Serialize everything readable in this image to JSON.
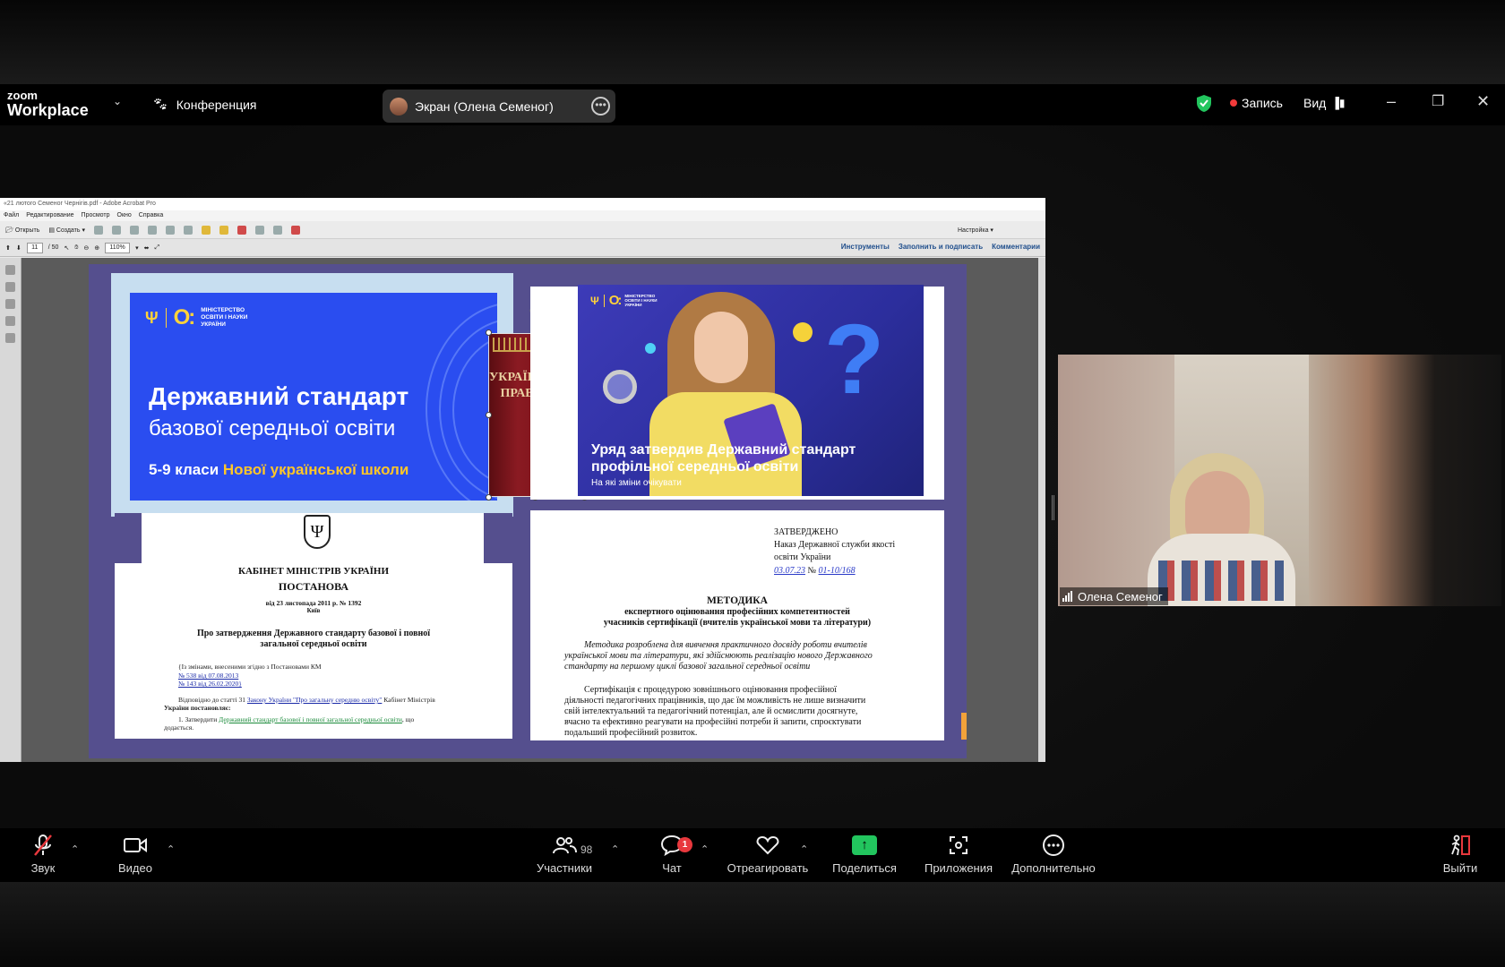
{
  "app": {
    "logo_small": "zoom",
    "logo_big": "Workplace",
    "conference_label": "Конференция",
    "screen_pill": "Экран (Олена Семеног)",
    "record_label": "Запись",
    "view_label": "Вид"
  },
  "acrobat": {
    "title": "«21 лютого Семеног Чернігів.pdf - Adobe Acrobat Pro",
    "menu": [
      "Файл",
      "Редактирование",
      "Просмотр",
      "Окно",
      "Справка"
    ],
    "open_label": "Открыть",
    "create_label": "Создать",
    "settings_label": "Настройка",
    "page_current": "11",
    "page_total": "/ 50",
    "zoom": "110%",
    "right_links": [
      "Инструменты",
      "Заполнить и подписать",
      "Комментарии"
    ]
  },
  "slide1": {
    "ministry": "МІНІСТЕРСТВО ОСВІТИ І НАУКИ УКРАЇНИ",
    "title1": "Державний стандарт",
    "title2": "базової середньої освіти",
    "grades": "5-9 класи",
    "grades_accent": "Нової української школи"
  },
  "book": {
    "title": "УКРАЇНСЬКИЙ ПРАВОПИС"
  },
  "slide2": {
    "ministry": "МІНІСТЕРСТВО ОСВІТИ І НАУКИ УКРАЇНИ",
    "caption1": "Уряд затвердив Державний стандарт",
    "caption2": "профільної середньої освіти",
    "sub": "На які зміни очікувати"
  },
  "doc1": {
    "org": "КАБІНЕТ МІНІСТРІВ УКРАЇНИ",
    "kind": "ПОСТАНОВА",
    "date": "від 23 листопада 2011 р. № 1392",
    "city": "Київ",
    "title1": "Про затвердження Державного стандарту базової і повної",
    "title2": "загальної середньої освіти",
    "changes": "{Із змінами, внесеними згідно з Постановами КМ",
    "change1": "№ 538 від 07.08.2013",
    "change2": "№ 143 від 26.02.2020}",
    "para1_a": "Відповідно до статті 31",
    "para1_link": "Закону України \"Про загальну середню освіту\"",
    "para1_b": "Кабінет Міністрів",
    "para1_c": "України постановляє:",
    "para2_a": "1. Затвердити",
    "para2_link": "Державний стандарт базової і повної загальної середньої освіти",
    "para2_b": ", що",
    "para2_c": "додається."
  },
  "doc2": {
    "approved": "ЗАТВЕРДЖЕНО",
    "order1": "Наказ Державної служби якості",
    "order2": "освіти України",
    "order_date": "03.07.23",
    "order_no_label": "№",
    "order_no": "01-10/168",
    "heading": "МЕТОДИКА",
    "sub1": "експертного оцінювання професійних компетентностей",
    "sub2": "учасників сертифікації (вчителів української мови та літератури)",
    "it1": "Методика розроблена для вивчення практичного досвіду роботи вчителів",
    "it2": "української мови та літератури, які здійснюють реалізацію нового Державного",
    "it3": "стандарту на першому циклі базової загальної середньої освіти",
    "p1": "Сертифікація є процедурою зовнішнього оцінювання професійної",
    "p2": "діяльності педагогічних працівників, що дає їм можливість не лише визначити",
    "p3": "свій інтелектуальний та педагогічний потенціал, але й осмислити досягнуте,",
    "p4": "вчасно та ефективно реагувати на професійні потреби й запити, спроєктувати",
    "p5": "подальший професійний розвиток."
  },
  "video": {
    "participant_name": "Олена Семеног"
  },
  "toolbar": {
    "audio": "Звук",
    "video": "Видео",
    "participants": "Участники",
    "participants_count": "98",
    "chat": "Чат",
    "chat_badge": "1",
    "react": "Отреагировать",
    "share": "Поделиться",
    "apps": "Приложения",
    "more": "Дополнительно",
    "leave": "Выйти"
  },
  "colors": {
    "accent_green": "#22c55e",
    "record_red": "#f23a3a",
    "slide_blue": "#2a4df0",
    "page_purple": "#554f8e"
  }
}
